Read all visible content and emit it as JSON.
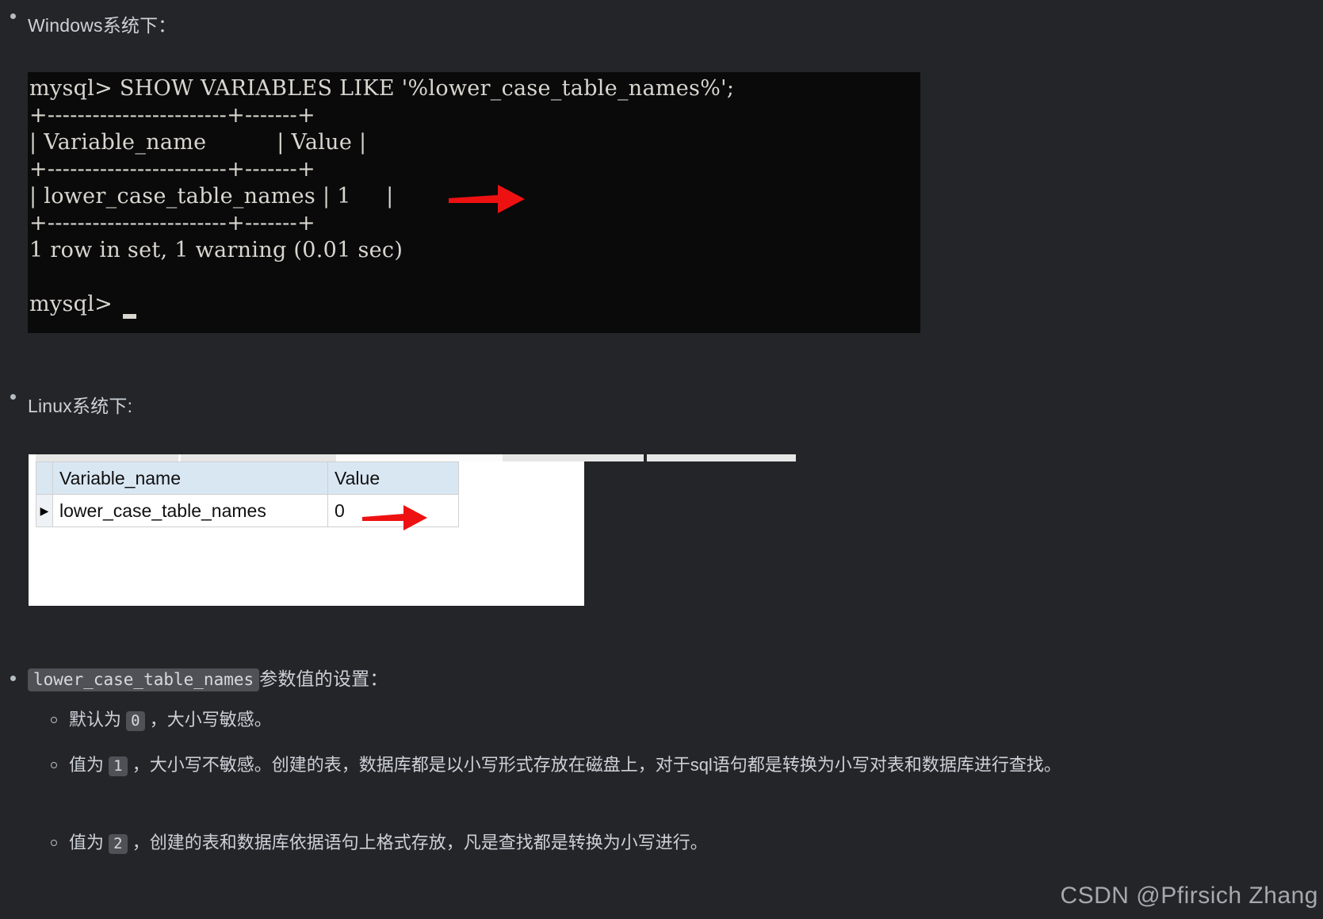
{
  "page": {
    "background_color": "#242529",
    "text_color": "#ccd1d8"
  },
  "sections": {
    "windows": {
      "bullet_label": "Windows系统下：",
      "terminal": {
        "background_color": "#0a0a0b",
        "text_color": "#d9d6cf",
        "lines": [
          "mysql> SHOW VARIABLES LIKE '%lower_case_table_names%';",
          "+------------------------+-------+",
          "| Variable_name          | Value |",
          "+------------------------+-------+",
          "| lower_case_table_names | 1     |",
          "+------------------------+-------+",
          "1 row in set, 1 warning (0.01 sec)",
          "",
          "mysql>"
        ],
        "cursor": "_"
      },
      "annotation_arrow_color": "#ee1111"
    },
    "linux": {
      "bullet_label": "Linux系统下:",
      "grid": {
        "columns": [
          "Variable_name",
          "Value"
        ],
        "rows": [
          {
            "selected": true,
            "row_marker": "▶",
            "cells": [
              "lower_case_table_names",
              "0"
            ]
          }
        ],
        "header_background": "#d9e7f3",
        "panel_background": "#ffffff"
      },
      "annotation_arrow_color": "#ee1111"
    },
    "settings": {
      "bullet_code": "lower_case_table_names",
      "bullet_suffix": "参数值的设置：",
      "items": [
        {
          "prefix": "默认为 ",
          "code": "0",
          "suffix": " ，大小写敏感。"
        },
        {
          "prefix": "值为 ",
          "code": "1",
          "suffix": " ，大小写不敏感。创建的表，数据库都是以小写形式存放在磁盘上，对于sql语句都是转换为小写对表和数据库进行查找。"
        },
        {
          "prefix": "值为 ",
          "code": "2",
          "suffix": " ，创建的表和数据库依据语句上格式存放，凡是查找都是转换为小写进行。"
        }
      ]
    }
  },
  "watermark": "CSDN @Pfirsich Zhang"
}
